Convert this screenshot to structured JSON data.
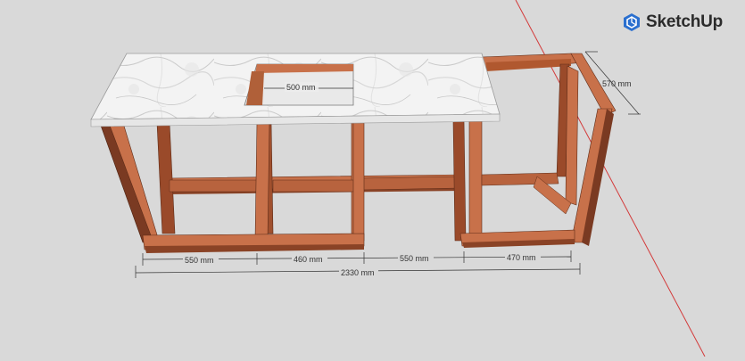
{
  "app": {
    "brand": "SketchUp",
    "logo_icon": "sketchup-logo-icon"
  },
  "colors": {
    "background": "#d9d9d9",
    "wood": "#c8714a",
    "wood_dark": "#7a3a22",
    "wood_shadow": "#5e2c18",
    "marble": "#f2f2f2",
    "axis_red": "#d33a3a",
    "brand_blue": "#2a6fcf"
  },
  "dimensions": {
    "sink_width": "500 mm",
    "depth_right": "570 mm",
    "segment_1": "550 mm",
    "segment_2": "460 mm",
    "segment_3": "550 mm",
    "segment_4": "470 mm",
    "total": "2330 mm"
  }
}
